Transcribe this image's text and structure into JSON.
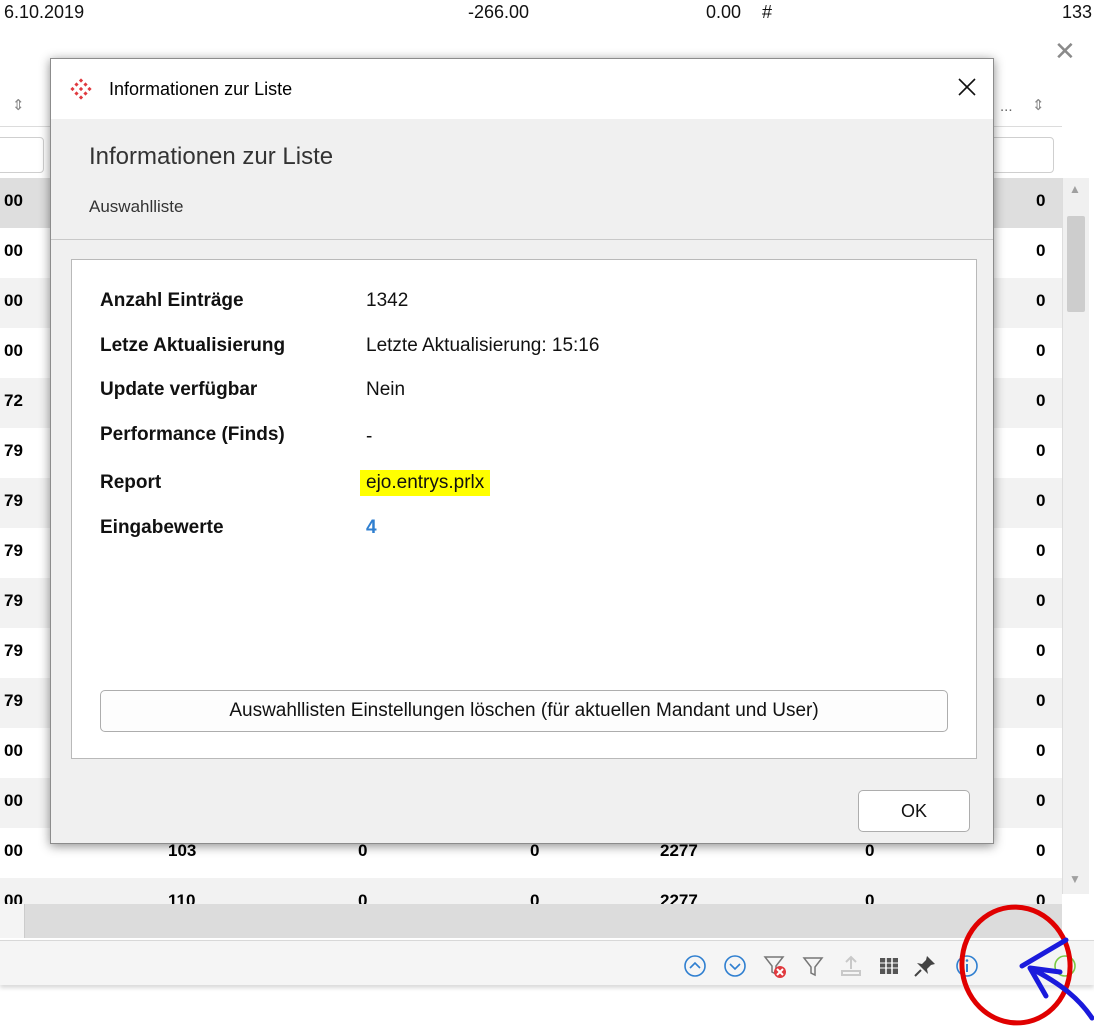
{
  "background": {
    "top_row": {
      "date": "6.10.2019",
      "amount": "-266.00",
      "value": "0.00",
      "hash": "#",
      "right": "133"
    },
    "header_right_label": "...",
    "rows": [
      {
        "left": "00",
        "right": "0"
      },
      {
        "left": "00",
        "right": "0"
      },
      {
        "left": "00",
        "right": "0"
      },
      {
        "left": "00",
        "right": "0"
      },
      {
        "left": "72",
        "right": "0"
      },
      {
        "left": "79",
        "right": "0"
      },
      {
        "left": "79",
        "right": "0"
      },
      {
        "left": "79",
        "right": "0"
      },
      {
        "left": "79",
        "right": "0"
      },
      {
        "left": "79",
        "right": "0"
      },
      {
        "left": "79",
        "right": "0"
      },
      {
        "left": "00",
        "right": "0"
      },
      {
        "left": "00",
        "right": "0"
      },
      {
        "left": "00",
        "right": "0",
        "cells": [
          "103",
          "0",
          "0",
          "2277",
          "0"
        ]
      },
      {
        "left": "00",
        "right": "0",
        "cells": [
          "110",
          "0",
          "0",
          "2277",
          "0"
        ]
      }
    ],
    "toolbar_icons": [
      "scroll-up-icon",
      "scroll-down-icon",
      "clear-filter-icon",
      "filter-icon",
      "export-icon",
      "columns-icon",
      "pin-icon",
      "info-icon",
      "refresh-icon"
    ]
  },
  "dialog": {
    "title": "Informationen zur Liste",
    "heading": "Informationen zur Liste",
    "subheading": "Auswahlliste",
    "info": {
      "entries_label": "Anzahl Einträge",
      "entries_value": "1342",
      "updated_label": "Letze Aktualisierung",
      "updated_value": "Letzte Aktualisierung:  15:16",
      "update_available_label": "Update verfügbar",
      "update_available_value": "Nein",
      "performance_label": "Performance (Finds)",
      "performance_value": "-",
      "report_label": "Report",
      "report_value": "ejo.entrys.prlx",
      "inputs_label": "Eingabewerte",
      "inputs_value": "4"
    },
    "reset_button": "Auswahllisten Einstellungen löschen (für aktuellen Mandant und User)",
    "ok_button": "OK"
  },
  "colors": {
    "highlight": "#ffff00",
    "link": "#2f7fd0",
    "annotation_circle": "#e00000",
    "annotation_arrow": "#1a1adc",
    "toolbar_icon_blue": "#2f7fd0",
    "logo_red": "#e0393e"
  }
}
